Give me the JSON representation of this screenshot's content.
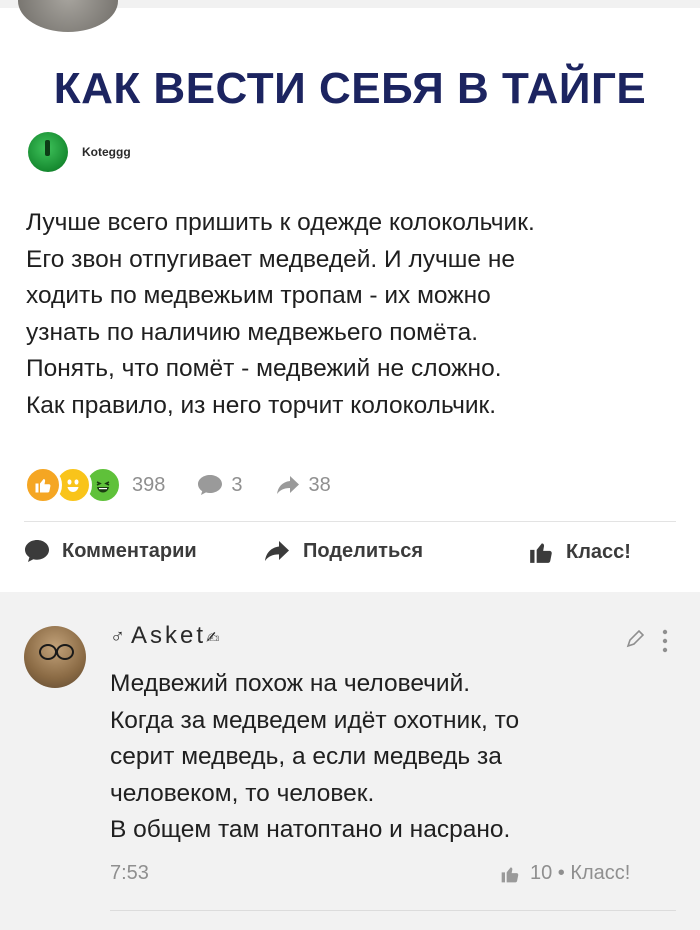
{
  "post": {
    "headline": "КАК ВЕСТИ СЕБЯ В ТАЙГЕ",
    "author": "Koteggg",
    "text": "Лучше всего пришить к одежде колокольчик.\nЕго звон отпугивает медведей. И лучше не\nходить по медвежьим тропам - их можно\nузнать по наличию медвежьего помёта.\nПонять, что помёт - медвежий не сложно.\nКак правило, из него торчит колокольчик.",
    "reactions_count": "398",
    "comments_count": "3",
    "shares_count": "38"
  },
  "actions": {
    "comments_label": "Комментарии",
    "share_label": "Поделиться",
    "like_label": "Класс!"
  },
  "comment": {
    "gender_symbol": "♂",
    "author": "Asket",
    "author_suffix": "✍",
    "text": "Медвежий похож на человечий.\nКогда за медведем идёт охотник, то\nсерит медведь, а если медведь за\nчеловеком, то человек.\nВ общем там натоптано и насрано.",
    "time": "7:53",
    "likes": "10 • Класс!"
  },
  "colors": {
    "headline": "#1c2460",
    "reaction_like": "#f5a623",
    "reaction_smile": "#f9c41a",
    "reaction_lol": "#5fc13a",
    "muted_text": "#8f8f8f",
    "comments_bg": "#f2f2f2"
  },
  "icons": [
    "like-reaction-icon",
    "smile-reaction-icon",
    "laugh-reaction-icon",
    "comment-bubble-icon",
    "share-arrow-icon",
    "thumbs-up-icon",
    "pencil-icon",
    "kebab-menu-icon"
  ]
}
